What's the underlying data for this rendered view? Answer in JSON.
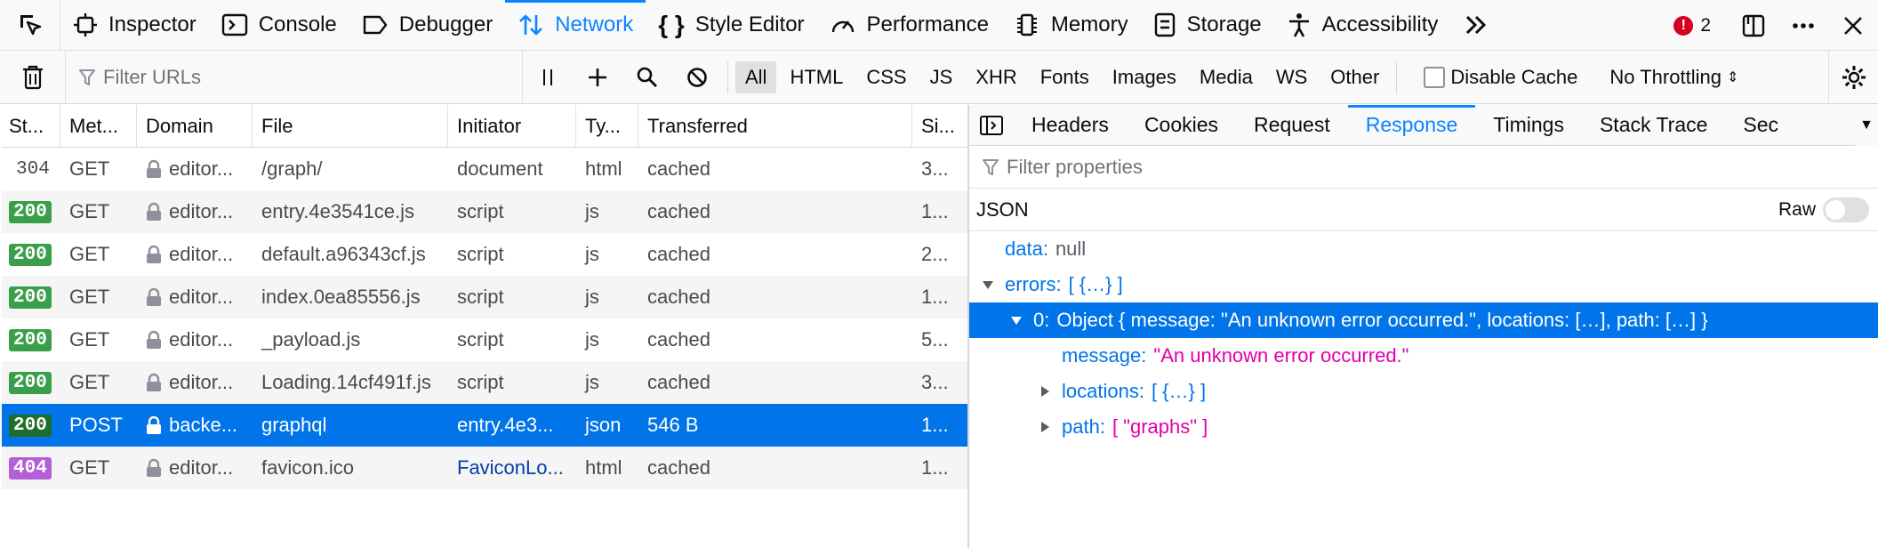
{
  "toolbar": {
    "tabs": [
      {
        "label": "Inspector",
        "icon": "inspector-icon"
      },
      {
        "label": "Console",
        "icon": "console-icon"
      },
      {
        "label": "Debugger",
        "icon": "debugger-icon"
      },
      {
        "label": "Network",
        "icon": "network-icon",
        "selected": true
      },
      {
        "label": "Style Editor",
        "icon": "style-editor-icon"
      },
      {
        "label": "Performance",
        "icon": "performance-icon"
      },
      {
        "label": "Memory",
        "icon": "memory-icon"
      },
      {
        "label": "Storage",
        "icon": "storage-icon"
      },
      {
        "label": "Accessibility",
        "icon": "accessibility-icon"
      }
    ],
    "error_count": "2"
  },
  "filterbar": {
    "url_placeholder": "Filter URLs",
    "types": [
      "All",
      "HTML",
      "CSS",
      "JS",
      "XHR",
      "Fonts",
      "Images",
      "Media",
      "WS",
      "Other"
    ],
    "disable_cache": "Disable Cache",
    "throttling": "No Throttling"
  },
  "table": {
    "headers": [
      "St...",
      "Met...",
      "Domain",
      "File",
      "Initiator",
      "Ty...",
      "Transferred",
      "Si..."
    ],
    "rows": [
      {
        "status": "304",
        "method": "GET",
        "domain": "editor...",
        "file": "/graph/",
        "initiator": "document",
        "type": "html",
        "transferred": "cached",
        "size": "3..."
      },
      {
        "status": "200",
        "method": "GET",
        "domain": "editor...",
        "file": "entry.4e3541ce.js",
        "initiator": "script",
        "type": "js",
        "transferred": "cached",
        "size": "1..."
      },
      {
        "status": "200",
        "method": "GET",
        "domain": "editor...",
        "file": "default.a96343cf.js",
        "initiator": "script",
        "type": "js",
        "transferred": "cached",
        "size": "2..."
      },
      {
        "status": "200",
        "method": "GET",
        "domain": "editor...",
        "file": "index.0ea85556.js",
        "initiator": "script",
        "type": "js",
        "transferred": "cached",
        "size": "1..."
      },
      {
        "status": "200",
        "method": "GET",
        "domain": "editor...",
        "file": "_payload.js",
        "initiator": "script",
        "type": "js",
        "transferred": "cached",
        "size": "5..."
      },
      {
        "status": "200",
        "method": "GET",
        "domain": "editor...",
        "file": "Loading.14cf491f.js",
        "initiator": "script",
        "type": "js",
        "transferred": "cached",
        "size": "3..."
      },
      {
        "status": "200",
        "method": "POST",
        "domain": "backe...",
        "file": "graphql",
        "initiator": "entry.4e3...",
        "type": "json",
        "transferred": "546 B",
        "size": "1...",
        "selected": true
      },
      {
        "status": "404",
        "method": "GET",
        "domain": "editor...",
        "file": "favicon.ico",
        "initiator": "FaviconLo...",
        "type": "html",
        "transferred": "cached",
        "size": "1...",
        "initiator_link": true
      }
    ]
  },
  "panel": {
    "tabs": [
      "Headers",
      "Cookies",
      "Request",
      "Response",
      "Timings",
      "Stack Trace",
      "Sec"
    ],
    "selected_tab": "Response",
    "filter_placeholder": "Filter properties",
    "json_label": "JSON",
    "raw_label": "Raw",
    "tree": [
      {
        "depth": 0,
        "key": "data:",
        "value": "null",
        "kind": "null",
        "twisty": "none"
      },
      {
        "depth": 0,
        "key": "errors:",
        "value": "[ {…} ]",
        "kind": "obj",
        "twisty": "open"
      },
      {
        "depth": 1,
        "key": "0:",
        "value": "Object { message: \"An unknown error occurred.\", locations: […], path: […] }",
        "kind": "obj",
        "twisty": "open",
        "selected": true
      },
      {
        "depth": 2,
        "key": "message:",
        "value": "\"An unknown error occurred.\"",
        "kind": "str",
        "twisty": "none"
      },
      {
        "depth": 2,
        "key": "locations:",
        "value": "[ {…} ]",
        "kind": "obj",
        "twisty": "closed"
      },
      {
        "depth": 2,
        "key": "path:",
        "value": "[ \"graphs\" ]",
        "kind": "str",
        "twisty": "closed"
      }
    ]
  },
  "colors": {
    "accent": "#0a84ff",
    "selected_row": "#0074e8",
    "status_ok": "#3a9f4a",
    "status_404": "#b35fd6",
    "error": "#d70022"
  }
}
